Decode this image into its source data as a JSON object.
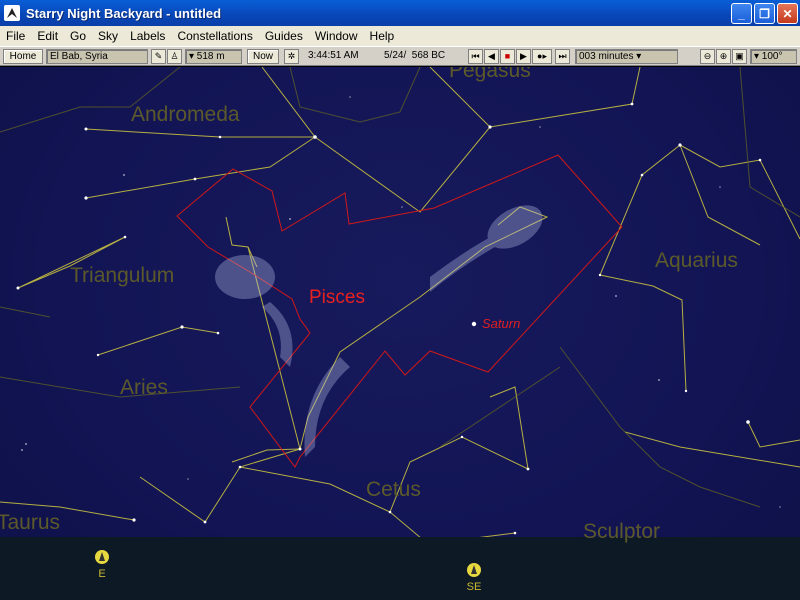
{
  "window": {
    "title": "Starry Night Backyard - untitled",
    "buttons": {
      "minimize": "_",
      "maximize": "❐",
      "close": "✕"
    }
  },
  "menu": [
    "File",
    "Edit",
    "Go",
    "Sky",
    "Labels",
    "Constellations",
    "Guides",
    "Window",
    "Help"
  ],
  "toolbar": {
    "home_label": "Home",
    "location": "El Bab, Syria",
    "elevation": "▾ 518 m",
    "now_label": "Now",
    "time": "3:44:51 AM",
    "date": "5/24/  568 BC",
    "time_step": "003 minutes ▾",
    "fov": "▾ 100°"
  },
  "sky": {
    "constellations": [
      "Pegasus",
      "Andromeda",
      "Triangulum",
      "Aries",
      "Cetus",
      "Taurus",
      "Sculptor",
      "Aquarius"
    ],
    "highlighted_constellation": "Pisces",
    "planet": "Saturn",
    "compass": [
      "E",
      "SE"
    ],
    "colors": {
      "sky": "#121454",
      "lines": "#c8c040",
      "boundary": "#d01818",
      "label": "#5c5a2a"
    }
  }
}
